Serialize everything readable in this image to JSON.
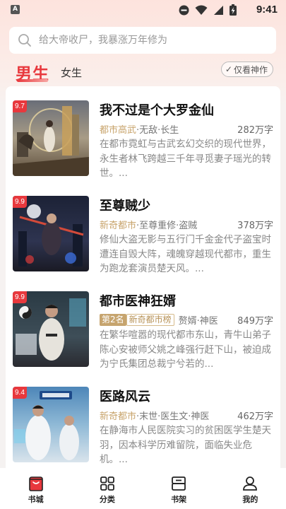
{
  "status_bar": {
    "app_indicator": "A",
    "time": "9:41",
    "icons": [
      "do-not-disturb-icon",
      "wifi-icon",
      "signal-icon",
      "battery-charging-icon"
    ]
  },
  "search": {
    "placeholder": "给大帝收尸，我暴涨万年修为"
  },
  "tabs": {
    "male": "男生",
    "female": "女生",
    "active": "男生"
  },
  "filter_chip": {
    "check": "✓",
    "label": "仅看神作"
  },
  "books": [
    {
      "score": "9.7",
      "title": "我不过是个大罗金仙",
      "category": "都市高武",
      "subtags": "·无敌·长生",
      "words": "282万字",
      "desc": "在都市霓虹与古武玄幻交织的现代世界，永生者林飞跨越三千年寻觅妻子瑶光的转世。..."
    },
    {
      "score": "9.9",
      "title": "至尊贼少",
      "category": "新奇都市",
      "subtags": "·至尊重修·盗贼",
      "words": "378万字",
      "desc": "修仙大盗无影与五行门千金金代子盗宝时遭连自毁大阵，魂魄穿越现代都市，重生为跑龙套演员楚天风。..."
    },
    {
      "score": "9.9",
      "title": "都市医神狂婿",
      "rank_tag": "第2名",
      "rank_list": "新奇都市榜",
      "subtags": "赘婿·神医",
      "words": "849万字",
      "desc": "在繁华喧嚣的现代都市东山，青牛山弟子陈心安被师父姚之峰强行赶下山，被迫成为宁氏集团总裁宁兮若的..."
    },
    {
      "score": "9.4",
      "title": "医路风云",
      "category": "新奇都市",
      "subtags": "·末世·医生文·神医",
      "words": "462万字",
      "desc": "在静海市人民医院实习的贫困医学生楚天羽，因本科学历难留院，面临失业危机。..."
    }
  ],
  "bottom_nav": [
    {
      "label": "书城",
      "icon": "bookstore-icon",
      "active": true
    },
    {
      "label": "分类",
      "icon": "category-grid-icon",
      "active": false
    },
    {
      "label": "书架",
      "icon": "bookshelf-icon",
      "active": false
    },
    {
      "label": "我的",
      "icon": "profile-icon",
      "active": false
    }
  ],
  "colors": {
    "accent": "#e8383d",
    "category_gold": "#c8a46c",
    "description_gray": "#888888"
  }
}
